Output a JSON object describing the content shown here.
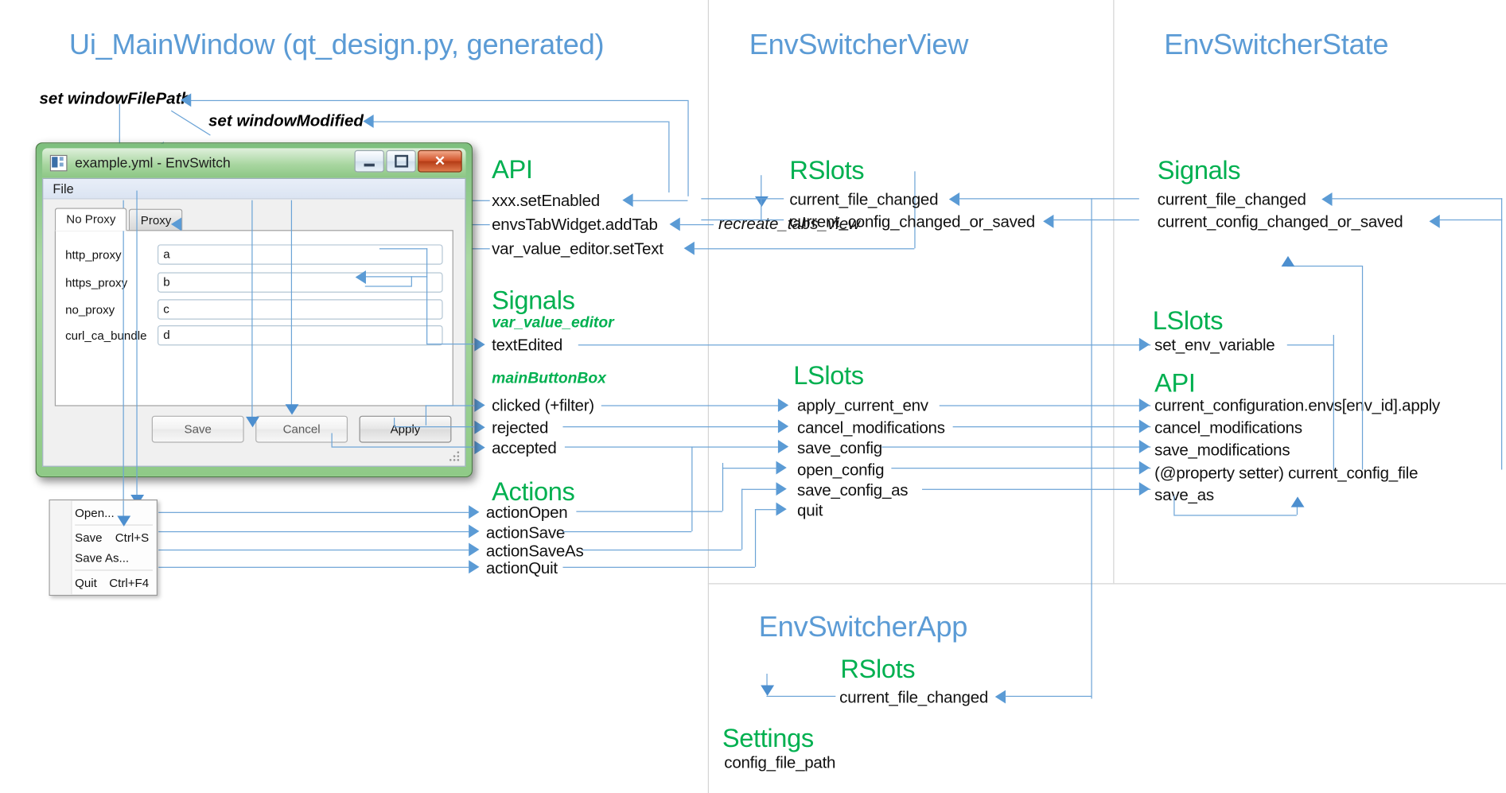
{
  "columns": {
    "left_title": "Ui_MainWindow (qt_design.py, generated)",
    "mid_title": "EnvSwitcherView",
    "right_title": "EnvSwitcherState",
    "app_title": "EnvSwitcherApp"
  },
  "notes": {
    "set_window_file_path": "set windowFilePath",
    "set_window_modified": "set windowModified",
    "recreate_tabs_view": "recreate_tabs_view"
  },
  "left": {
    "api_head": "API",
    "api_items": [
      "xxx.setEnabled",
      "envsTabWidget.addTab",
      "var_value_editor.setText"
    ],
    "signals_head": "Signals",
    "signals_sub1": "var_value_editor",
    "signals_sub1_items": [
      "textEdited"
    ],
    "signals_sub2": "mainButtonBox",
    "signals_sub2_items": [
      "clicked (+filter)",
      "rejected",
      "accepted"
    ],
    "actions_head": "Actions",
    "actions_items": [
      "actionOpen",
      "actionSave",
      "actionSaveAs",
      "actionQuit"
    ]
  },
  "mid": {
    "rslots_head": "RSlots",
    "rslots_items": [
      "current_file_changed",
      "current_config_changed_or_saved"
    ],
    "lslots_head": "LSlots",
    "lslots_items": [
      "apply_current_env",
      "cancel_modifications",
      "save_config",
      "open_config",
      "save_config_as",
      "quit"
    ]
  },
  "right": {
    "signals_head": "Signals",
    "signals_items": [
      "current_file_changed",
      "current_config_changed_or_saved"
    ],
    "lslots_head": "LSlots",
    "lslots_items": [
      "set_env_variable"
    ],
    "api_head": "API",
    "api_items": [
      "current_configuration.envs[env_id].apply",
      "cancel_modifications",
      "save_modifications",
      "(@property setter) current_config_file",
      "save_as"
    ]
  },
  "app": {
    "rslots_head": "RSlots",
    "rslots_items": [
      "current_file_changed"
    ],
    "settings_head": "Settings",
    "settings_items": [
      "config_file_path"
    ]
  },
  "window": {
    "title": "example.yml - EnvSwitch",
    "minimize_glyph": "–",
    "maximize_glyph": "□",
    "close_glyph": "✕",
    "menu_file": "File",
    "tabs": [
      "No Proxy",
      "Proxy"
    ],
    "selected_tab": "No Proxy",
    "fields": [
      {
        "label": "http_proxy",
        "value": "a"
      },
      {
        "label": "https_proxy",
        "value": "b"
      },
      {
        "label": "no_proxy",
        "value": "c"
      },
      {
        "label": "curl_ca_bundle",
        "value": "d"
      }
    ],
    "buttons": [
      {
        "label": "Save",
        "state": "disabled"
      },
      {
        "label": "Cancel",
        "state": "disabled"
      },
      {
        "label": "Apply",
        "state": "enabled"
      }
    ]
  },
  "file_menu": {
    "items": [
      {
        "label": "Open...",
        "accel": ""
      },
      {
        "label": "Save",
        "accel": "Ctrl+S"
      },
      {
        "label": "Save As...",
        "accel": ""
      },
      {
        "label": "Quit",
        "accel": "Ctrl+F4"
      }
    ]
  },
  "colors": {
    "class_title": "#5b9bd5",
    "section_head": "#00b050",
    "connector": "#6ba3d6",
    "window_frame": "#8fca87"
  }
}
